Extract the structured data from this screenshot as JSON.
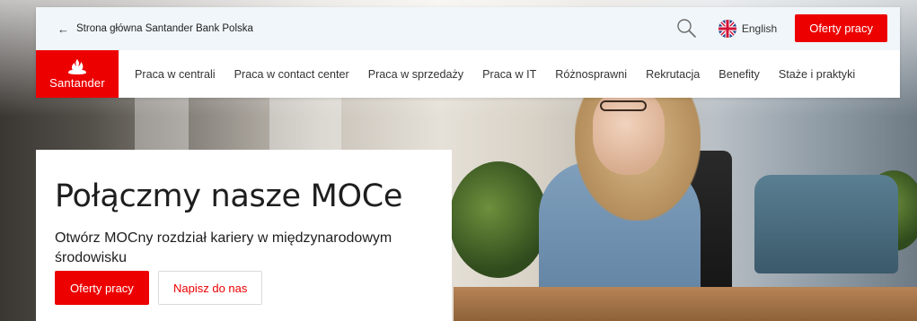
{
  "topbar": {
    "back_link": "Strona główna Santander Bank Polska",
    "back_arrow": "←",
    "language": "English",
    "cta": "Oferty pracy"
  },
  "logo": {
    "word": "Santander"
  },
  "nav": {
    "items": [
      "Praca w centrali",
      "Praca w contact center",
      "Praca w sprzedaży",
      "Praca w IT",
      "Różnosprawni",
      "Rekrutacja",
      "Benefity",
      "Staże i praktyki"
    ]
  },
  "hero": {
    "title": "Połączmy nasze MOCe",
    "subtitle": "Otwórz MOCny rozdział kariery w międzynarodowym środowisku",
    "primary_button": "Oferty pracy",
    "secondary_button": "Napisz do nas"
  },
  "colors": {
    "brand_red": "#ec0000",
    "topbar_bg": "#f0f6f9"
  },
  "icons": {
    "search": "search-icon",
    "flag": "uk-flag-icon",
    "back": "arrow-left-icon",
    "logo": "santander-flame-icon"
  }
}
